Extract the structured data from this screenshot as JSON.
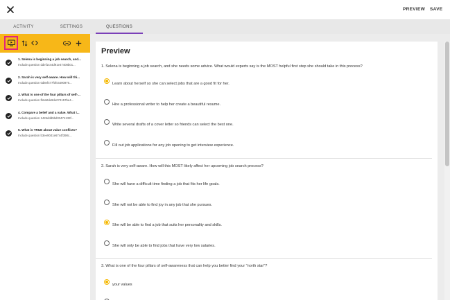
{
  "header": {
    "close_icon": "close-icon",
    "preview_label": "PREVIEW",
    "save_label": "SAVE"
  },
  "tabs": [
    {
      "label": "ACTIVITY",
      "active": false
    },
    {
      "label": "SETTINGS",
      "active": false
    },
    {
      "label": "QUESTIONS",
      "active": true
    }
  ],
  "toolbar": {
    "icons": [
      "preview-icon",
      "sort-icon",
      "code-icon",
      "link-icon",
      "add-icon"
    ],
    "accent": "#f7b718",
    "highlight": "#e0247c"
  },
  "questions_list": [
    {
      "title": "1. Selena is beginning a job search, and...",
      "sub": "Include question ddef1444d91e47408b01..."
    },
    {
      "title": "2. Sarah is very self-aware. How will thi...",
      "sub": "Include question 0d8ef477f0fc6490976..."
    },
    {
      "title": "3. What is one of the four pillars of self-...",
      "sub": "Include question fb6a0de9de074157be4..."
    },
    {
      "title": "4. Compare a belief and a value. What i...",
      "sub": "Include question 1426ddd5bd33474133f..."
    },
    {
      "title": "5. What is TRUE about value conflicts?",
      "sub": "Include question b3ee9041e6744f398c..."
    }
  ],
  "preview": {
    "title": "Preview",
    "questions": [
      {
        "text": "1. Selena is beginning a job search, and she needs some advice. What would experts say is the MOST helpful first step she should take in this process?",
        "options": [
          {
            "label": "Learn about herself so she can select jobs that are a good fit for her.",
            "selected": true
          },
          {
            "label": "Hire a professional writer to help her create a beautiful resume.",
            "selected": false
          },
          {
            "label": "Write several drafts of a cover letter so friends can select the best one.",
            "selected": false
          },
          {
            "label": "Fill out job applications for any job opening to get interview experience.",
            "selected": false
          }
        ]
      },
      {
        "text": "2. Sarah is very self-aware. How will this MOST likely affect her upcoming job search process?",
        "options": [
          {
            "label": "She will have a difficult time finding a job that fits her life goals.",
            "selected": false
          },
          {
            "label": "She will not be able to find joy in any job that she pursues.",
            "selected": false
          },
          {
            "label": "She will be able to find a job that suits her personality and skills.",
            "selected": true
          },
          {
            "label": "She will only be able to find jobs that have very low salaries.",
            "selected": false
          }
        ]
      },
      {
        "text": "3. What is one of the four pillars of self-awareness that can help you better find your \"north star\"?",
        "options": [
          {
            "label": "your values",
            "selected": true
          }
        ]
      }
    ]
  },
  "colors": {
    "selected_radio": "#f5b800",
    "tab_underline": "#7a3fb8"
  }
}
